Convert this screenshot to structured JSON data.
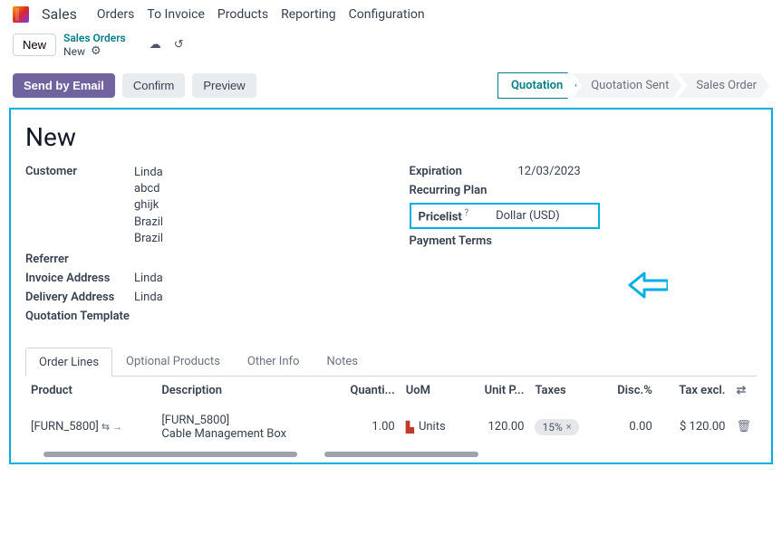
{
  "nav": {
    "app": "Sales",
    "items": [
      "Orders",
      "To Invoice",
      "Products",
      "Reporting",
      "Configuration"
    ]
  },
  "breadcrumb": {
    "new_btn": "New",
    "title": "Sales Orders",
    "subtitle": "New"
  },
  "actions": {
    "send": "Send by Email",
    "confirm": "Confirm",
    "preview": "Preview"
  },
  "stages": [
    "Quotation",
    "Quotation Sent",
    "Sales Order"
  ],
  "doc": {
    "title": "New",
    "left": {
      "customer_label": "Customer",
      "customer_lines": [
        "Linda",
        "abcd",
        "ghijk",
        "Brazil",
        "Brazil"
      ],
      "referrer_label": "Referrer",
      "invoice_label": "Invoice Address",
      "invoice_val": "Linda",
      "delivery_label": "Delivery Address",
      "delivery_val": "Linda",
      "template_label": "Quotation Template"
    },
    "right": {
      "expiration_label": "Expiration",
      "expiration_val": "12/03/2023",
      "recurring_label": "Recurring Plan",
      "pricelist_label": "Pricelist",
      "pricelist_val": "Dollar (USD)",
      "payment_label": "Payment Terms"
    }
  },
  "tabs": [
    "Order Lines",
    "Optional Products",
    "Other Info",
    "Notes"
  ],
  "table": {
    "headers": {
      "product": "Product",
      "desc": "Description",
      "qty": "Quanti...",
      "uom": "UoM",
      "unitp": "Unit P...",
      "taxes": "Taxes",
      "disc": "Disc.%",
      "taxexcl": "Tax excl."
    },
    "row": {
      "product": "[FURN_5800]",
      "desc_code": "[FURN_5800]",
      "desc_name": "Cable Management Box",
      "qty": "1.00",
      "uom": "Units",
      "unitp": "120.00",
      "tax": "15%",
      "disc": "0.00",
      "taxexcl": "$ 120.00"
    }
  }
}
